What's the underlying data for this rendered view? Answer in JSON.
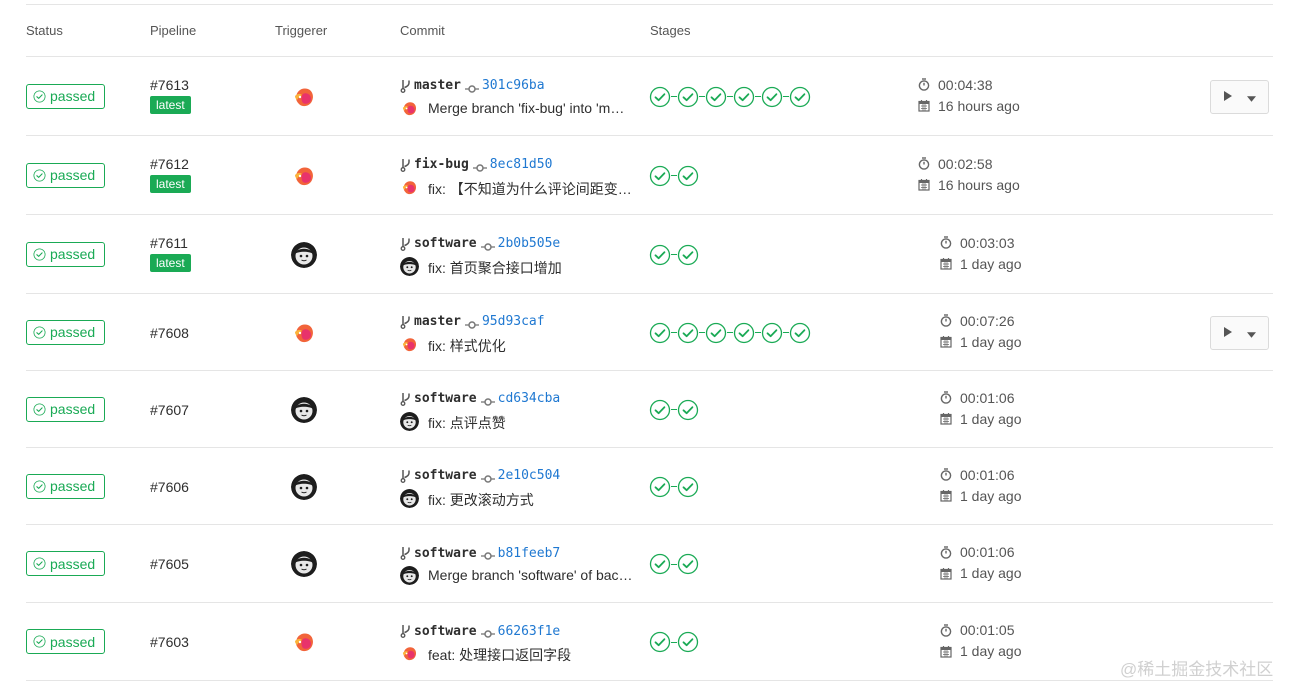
{
  "header": {
    "status": "Status",
    "pipeline": "Pipeline",
    "triggerer": "Triggerer",
    "commit": "Commit",
    "stages": "Stages"
  },
  "colors": {
    "success": "#1aaa55",
    "link": "#1f78d1",
    "border": "#e5e5e5"
  },
  "rows": [
    {
      "status": "passed",
      "id": "#7613",
      "latest": "latest",
      "avatar": "orange-fox",
      "branch": "master",
      "sha": "301c96ba",
      "message": "Merge branch 'fix-bug' into 'm…",
      "stages": 6,
      "duration": "00:04:38",
      "finished": "16 hours ago",
      "has_action": true
    },
    {
      "status": "passed",
      "id": "#7612",
      "latest": "latest",
      "avatar": "orange-fox",
      "branch": "fix-bug",
      "sha": "8ec81d50",
      "message": "fix: 【不知道为什么评论间距变…",
      "stages": 2,
      "duration": "00:02:58",
      "finished": "16 hours ago",
      "has_action": false
    },
    {
      "status": "passed",
      "id": "#7611",
      "latest": "latest",
      "avatar": "dark-face",
      "branch": "software",
      "sha": "2b0b505e",
      "message": "fix: 首页聚合接口增加",
      "stages": 2,
      "duration": "00:03:03",
      "finished": "1 day ago",
      "has_action": false
    },
    {
      "status": "passed",
      "id": "#7608",
      "latest": "",
      "avatar": "orange-fox",
      "branch": "master",
      "sha": "95d93caf",
      "message": "fix: 样式优化",
      "stages": 6,
      "duration": "00:07:26",
      "finished": "1 day ago",
      "has_action": true
    },
    {
      "status": "passed",
      "id": "#7607",
      "latest": "",
      "avatar": "dark-face",
      "branch": "software",
      "sha": "cd634cba",
      "message": "fix: 点评点赞",
      "stages": 2,
      "duration": "00:01:06",
      "finished": "1 day ago",
      "has_action": false
    },
    {
      "status": "passed",
      "id": "#7606",
      "latest": "",
      "avatar": "dark-face",
      "branch": "software",
      "sha": "2e10c504",
      "message": "fix: 更改滚动方式",
      "stages": 2,
      "duration": "00:01:06",
      "finished": "1 day ago",
      "has_action": false
    },
    {
      "status": "passed",
      "id": "#7605",
      "latest": "",
      "avatar": "dark-face",
      "branch": "software",
      "sha": "b81feeb7",
      "message": "Merge branch 'software' of bac…",
      "stages": 2,
      "duration": "00:01:06",
      "finished": "1 day ago",
      "has_action": false
    },
    {
      "status": "passed",
      "id": "#7603",
      "latest": "",
      "avatar": "orange-fox",
      "branch": "software",
      "sha": "66263f1e",
      "message": "feat: 处理接口返回字段",
      "stages": 2,
      "duration": "00:01:05",
      "finished": "1 day ago",
      "has_action": false
    }
  ],
  "watermark": "@稀土掘金技术社区"
}
